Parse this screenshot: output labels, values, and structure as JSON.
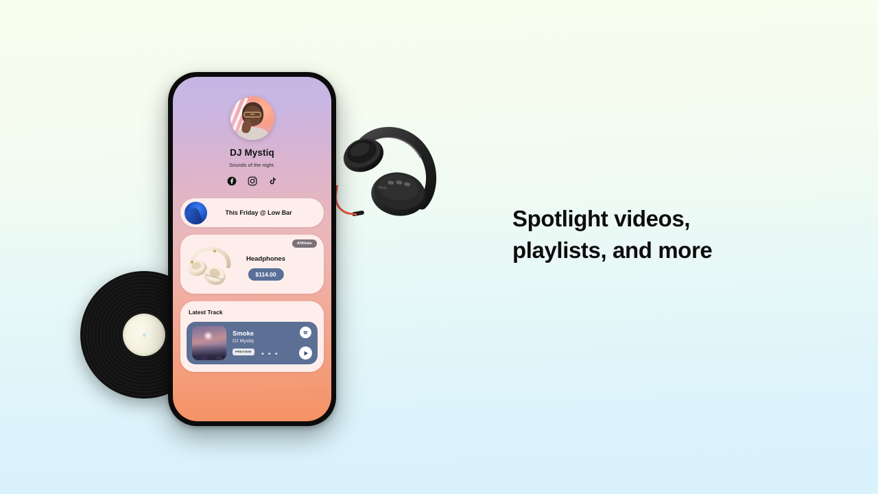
{
  "headline": {
    "line1": "Spotlight videos,",
    "line2": "playlists, and more"
  },
  "phone": {
    "profile": {
      "name": "DJ Mystiq",
      "bio": "Sounds of the night.",
      "avatar_alt": "avatar-photo",
      "socials": [
        {
          "name": "facebook-icon",
          "label": "Facebook"
        },
        {
          "name": "instagram-icon",
          "label": "Instagram"
        },
        {
          "name": "tiktok-icon",
          "label": "TikTok"
        }
      ]
    },
    "link_card": {
      "label": "This Friday @ Low Bar",
      "thumb_name": "link-thumbnail"
    },
    "product_card": {
      "badge": "Affiliate",
      "title": "Headphones",
      "price": "$114.00",
      "image_name": "headphones-product-image"
    },
    "track_card": {
      "section_title": "Latest Track",
      "track_title": "Smoke",
      "track_artist": "DJ Mystiq",
      "preview_badge": "PREVIEW",
      "more_dots": "• • •",
      "spotify_icon": "spotify-icon",
      "play_icon": "play-icon",
      "album_art_name": "album-artwork"
    }
  },
  "decor": {
    "vinyl": "vinyl-record",
    "headphones": "headphones-prop"
  },
  "colors": {
    "background_top": "#f9fdee",
    "background_bottom": "#d9f2fc",
    "screen_top": "#c6b5e4",
    "screen_bottom": "#f59164",
    "card_bg": "#fdeeec",
    "price_pill": "#5a7099",
    "player_bg": "#5c6f94",
    "badge_gray": "#7b7178",
    "headline_color": "#0d0d0d"
  }
}
